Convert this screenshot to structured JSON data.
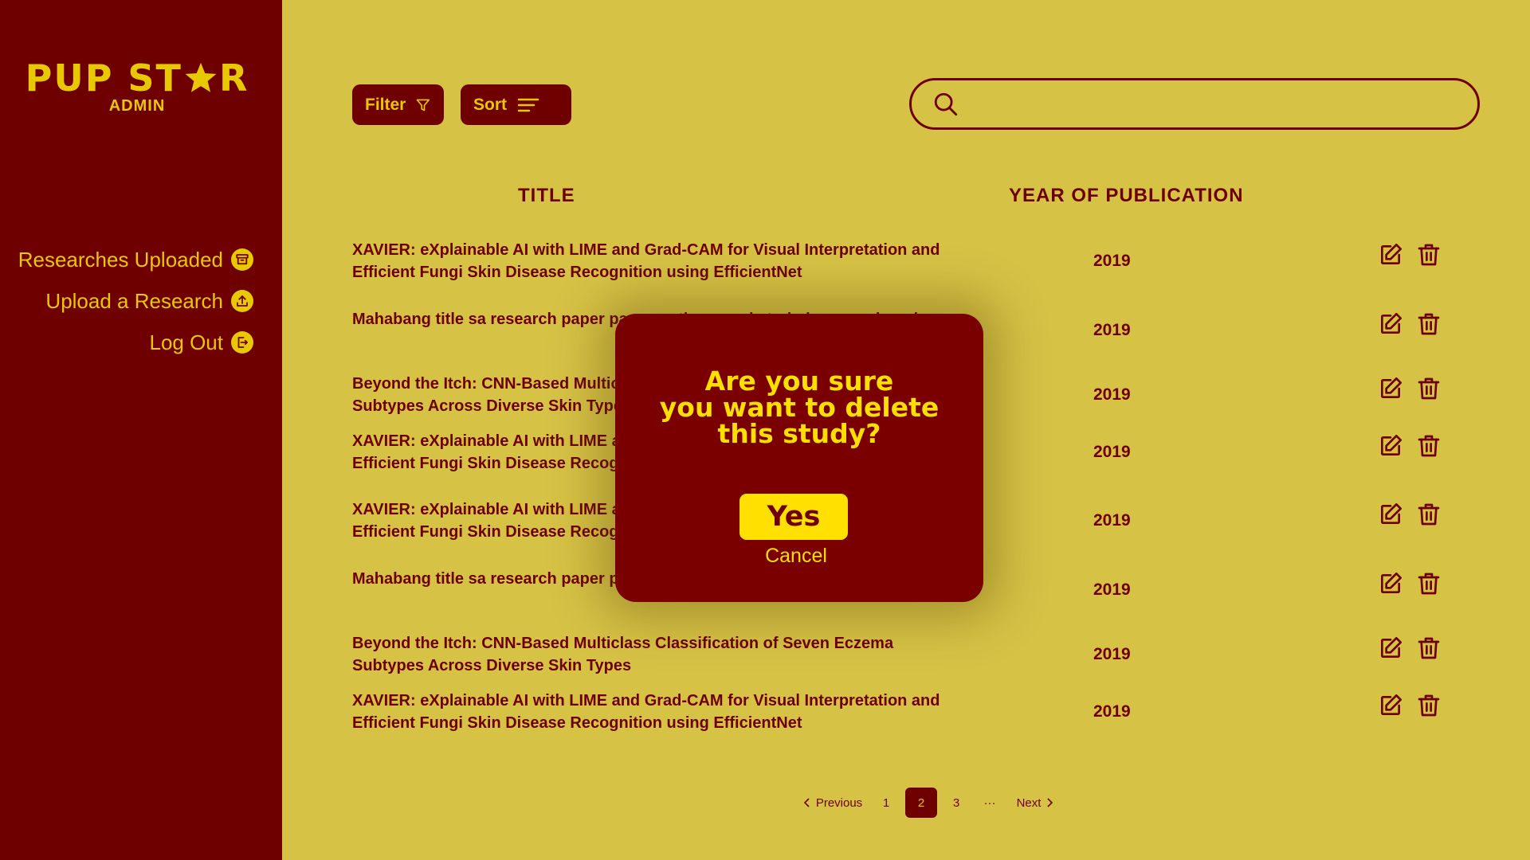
{
  "sidebar": {
    "brand_left": "PUP ST",
    "brand_right": "R",
    "brand_sub": "ADMIN",
    "items": [
      {
        "label": "Researches Uploaded",
        "icon": "archive-icon"
      },
      {
        "label": "Upload a Research",
        "icon": "upload-icon"
      },
      {
        "label": "Log Out",
        "icon": "logout-icon"
      }
    ]
  },
  "toolbar": {
    "filter_label": "Filter",
    "sort_label": "Sort",
    "search_placeholder": ""
  },
  "table": {
    "headers": {
      "title": "TITLE",
      "year": "YEAR OF PUBLICATION"
    },
    "rows": [
      {
        "title": "XAVIER: eXplainable AI with LIME and Grad-CAM for Visual Interpretation and Efficient Fungi Skin Disease Recognition using EfficientNet",
        "year": "2019"
      },
      {
        "title": "Mahabang title sa research paper para sa ating mga katrabaho na mabangis",
        "year": "2019"
      },
      {
        "title": "Beyond the Itch: CNN-Based Multiclass Classification of Seven Eczema Subtypes Across Diverse Skin Types",
        "year": "2019"
      },
      {
        "title": "XAVIER: eXplainable AI with LIME and Grad-CAM for Visual Interpretation and Efficient Fungi Skin Disease Recognition using EfficientNet",
        "year": "2019"
      },
      {
        "title": "XAVIER: eXplainable AI with LIME and Grad-CAM for Visual Interpretation and Efficient Fungi Skin Disease Recognition using EfficientNet",
        "year": "2019"
      },
      {
        "title": "Mahabang title sa research paper para sa ating mga katrabaho na mabangis",
        "year": "2019"
      },
      {
        "title": "Beyond the Itch: CNN-Based Multiclass Classification of Seven Eczema Subtypes Across Diverse Skin Types",
        "year": "2019"
      },
      {
        "title": "XAVIER: eXplainable AI with LIME and Grad-CAM for Visual Interpretation and Efficient Fungi Skin Disease Recognition using EfficientNet",
        "year": "2019"
      }
    ]
  },
  "pagination": {
    "previous": "Previous",
    "pages": [
      "1",
      "2",
      "3"
    ],
    "current": "2",
    "ellipsis": "···",
    "next": "Next"
  },
  "modal": {
    "question_lines": [
      "Are you sure",
      "you want to delete",
      "this study?"
    ],
    "yes_label": "Yes",
    "cancel_label": "Cancel"
  },
  "colors": {
    "maroon": "#6e0000",
    "gold": "#e8c800",
    "background": "#d6c245",
    "modal_bg": "#7a0000",
    "yes_bg": "#ffe000"
  }
}
